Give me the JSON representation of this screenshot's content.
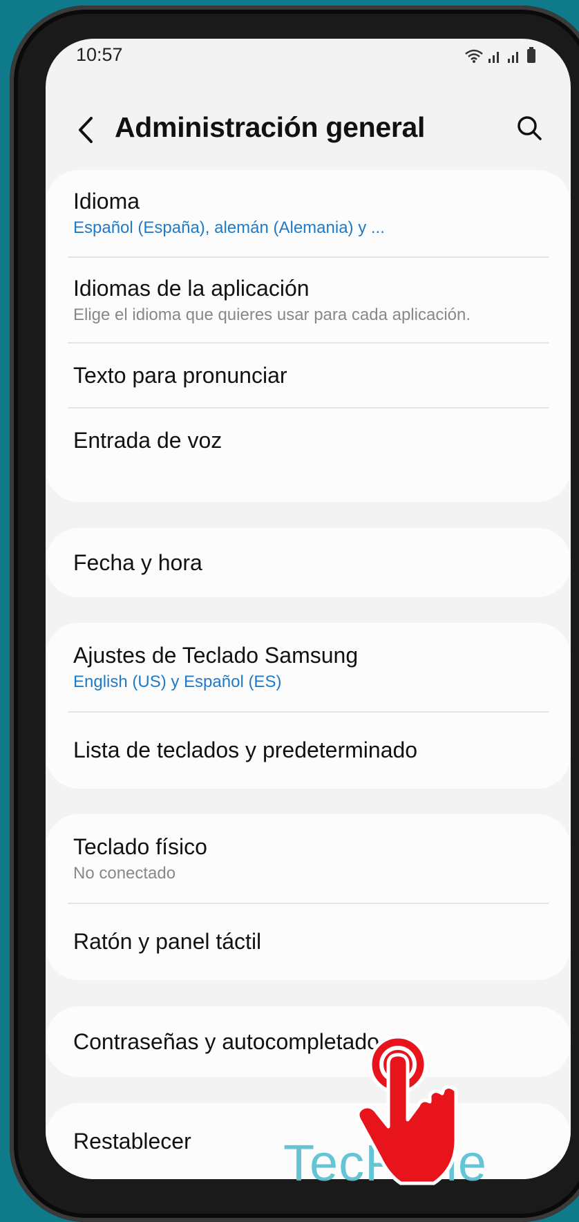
{
  "status": {
    "time": "10:57"
  },
  "header": {
    "title": "Administración general"
  },
  "groups": {
    "g1": [
      {
        "title": "Idioma",
        "sub": "Español (España), alemán (Alemania) y ..."
      },
      {
        "title": "Idiomas de la aplicación",
        "sub": "Elige el idioma que quieres usar para cada aplicación."
      },
      {
        "title": "Texto para pronunciar"
      },
      {
        "title": "Entrada de voz"
      }
    ],
    "g2": [
      {
        "title": "Fecha y hora"
      }
    ],
    "g3": [
      {
        "title": "Ajustes de Teclado Samsung",
        "sub": "English (US) y Español (ES)"
      },
      {
        "title": "Lista de teclados y predeterminado"
      }
    ],
    "g4": [
      {
        "title": "Teclado físico",
        "sub": "No conectado"
      },
      {
        "title": "Ratón y panel táctil"
      }
    ],
    "g5": [
      {
        "title": "Contraseñas y autocompletado"
      }
    ],
    "g6": [
      {
        "title": "Restablecer"
      }
    ]
  },
  "watermark": "TecPone",
  "colors": {
    "accent": "#1f7ac7",
    "background": "#0e7a8a",
    "hand": "#e8141c"
  }
}
